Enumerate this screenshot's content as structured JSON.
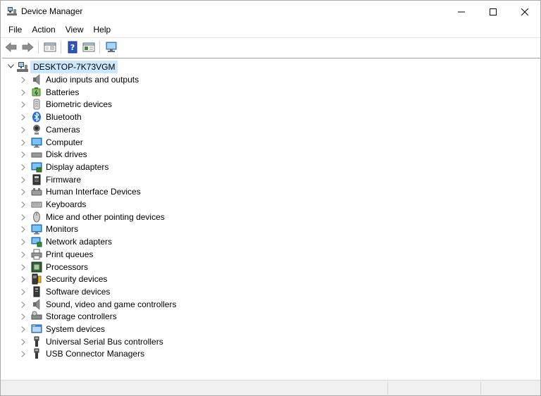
{
  "window": {
    "title": "Device Manager",
    "icon": "device-manager-icon"
  },
  "menu": {
    "items": [
      {
        "label": "File"
      },
      {
        "label": "Action"
      },
      {
        "label": "View"
      },
      {
        "label": "Help"
      }
    ]
  },
  "toolbar": {
    "buttons": [
      {
        "icon": "back-arrow-icon"
      },
      {
        "icon": "forward-arrow-icon"
      },
      {
        "icon": "show-hide-console-tree-icon"
      },
      {
        "icon": "help-icon"
      },
      {
        "icon": "properties-icon"
      },
      {
        "icon": "scan-hardware-changes-icon"
      }
    ]
  },
  "tree": {
    "root": {
      "label": "DESKTOP-7K73VGM",
      "expanded": true,
      "icon": "computer-network-icon"
    },
    "categories": [
      {
        "label": "Audio inputs and outputs",
        "icon": "speaker-icon"
      },
      {
        "label": "Batteries",
        "icon": "battery-icon"
      },
      {
        "label": "Biometric devices",
        "icon": "fingerprint-icon"
      },
      {
        "label": "Bluetooth",
        "icon": "bluetooth-icon"
      },
      {
        "label": "Cameras",
        "icon": "camera-icon"
      },
      {
        "label": "Computer",
        "icon": "computer-monitor-icon"
      },
      {
        "label": "Disk drives",
        "icon": "disk-drive-icon"
      },
      {
        "label": "Display adapters",
        "icon": "display-adapter-icon"
      },
      {
        "label": "Firmware",
        "icon": "firmware-chip-icon"
      },
      {
        "label": "Human Interface Devices",
        "icon": "hid-icon"
      },
      {
        "label": "Keyboards",
        "icon": "keyboard-icon"
      },
      {
        "label": "Mice and other pointing devices",
        "icon": "mouse-icon"
      },
      {
        "label": "Monitors",
        "icon": "monitor-icon"
      },
      {
        "label": "Network adapters",
        "icon": "network-adapter-icon"
      },
      {
        "label": "Print queues",
        "icon": "printer-icon"
      },
      {
        "label": "Processors",
        "icon": "processor-icon"
      },
      {
        "label": "Security devices",
        "icon": "security-key-icon"
      },
      {
        "label": "Software devices",
        "icon": "software-device-icon"
      },
      {
        "label": "Sound, video and game controllers",
        "icon": "sound-icon"
      },
      {
        "label": "Storage controllers",
        "icon": "storage-controller-icon"
      },
      {
        "label": "System devices",
        "icon": "system-devices-icon"
      },
      {
        "label": "Universal Serial Bus controllers",
        "icon": "usb-icon"
      },
      {
        "label": "USB Connector Managers",
        "icon": "usb-connector-icon"
      }
    ]
  },
  "colors": {
    "selection": "#cce8ff",
    "accent_blue": "#1e88e5"
  }
}
